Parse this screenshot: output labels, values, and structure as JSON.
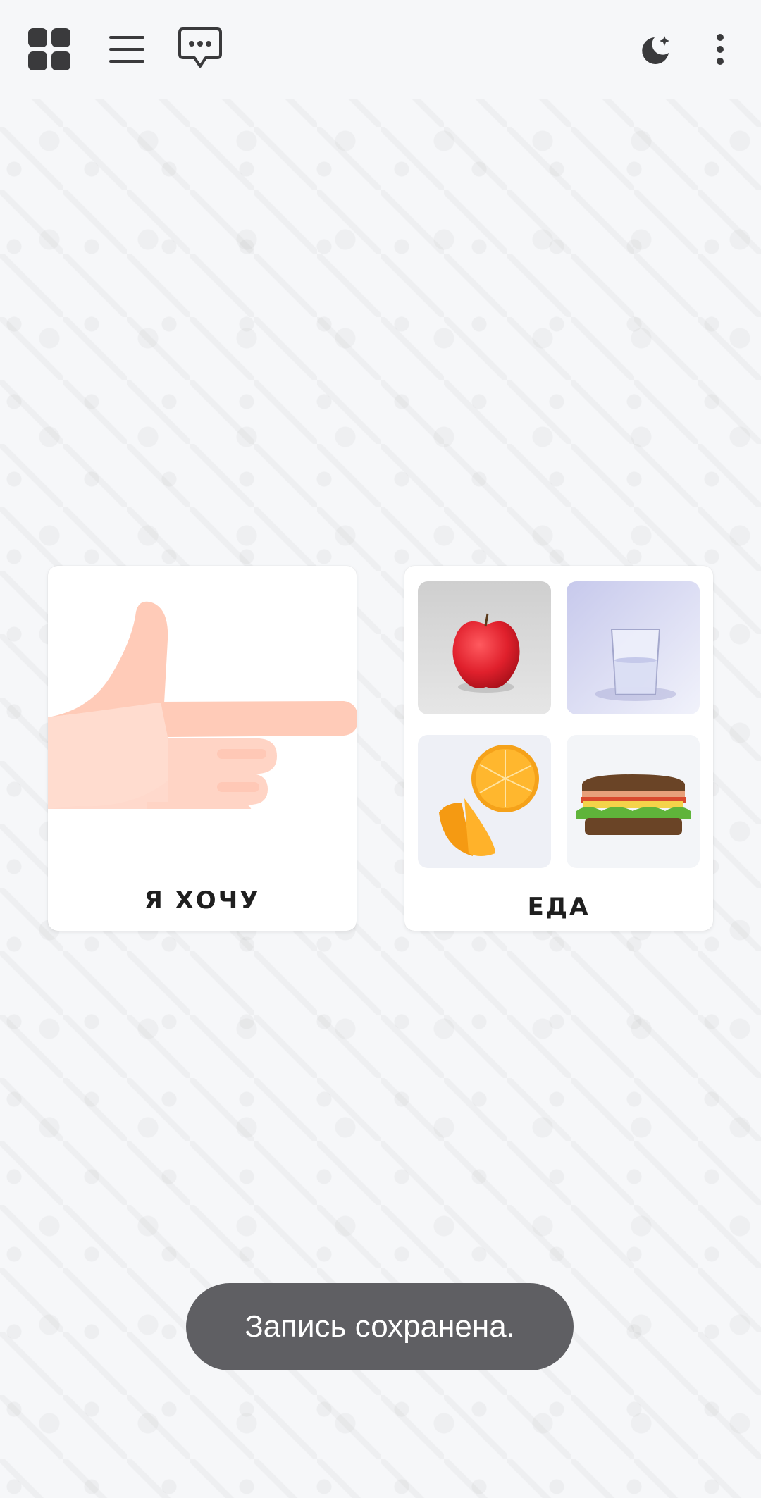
{
  "toolbar": {
    "left_icons": [
      "grid-icon",
      "menu-icon",
      "speech-bubble-icon"
    ],
    "right_icons": [
      "night-mode-icon",
      "more-vertical-icon"
    ]
  },
  "cards": [
    {
      "label": "Я ХОЧУ",
      "icon": "pointing-hand-icon"
    },
    {
      "label": "ЕДА",
      "images": [
        "apple-image",
        "glass-of-water-image",
        "orange-slices-image",
        "sandwich-image"
      ]
    }
  ],
  "toast": {
    "text": "Запись сохранена."
  },
  "colors": {
    "background": "#f6f7f9",
    "icon": "#3a3a3c",
    "card": "#ffffff",
    "toast": "#5f5f63",
    "hand": "#ffd9cc"
  }
}
